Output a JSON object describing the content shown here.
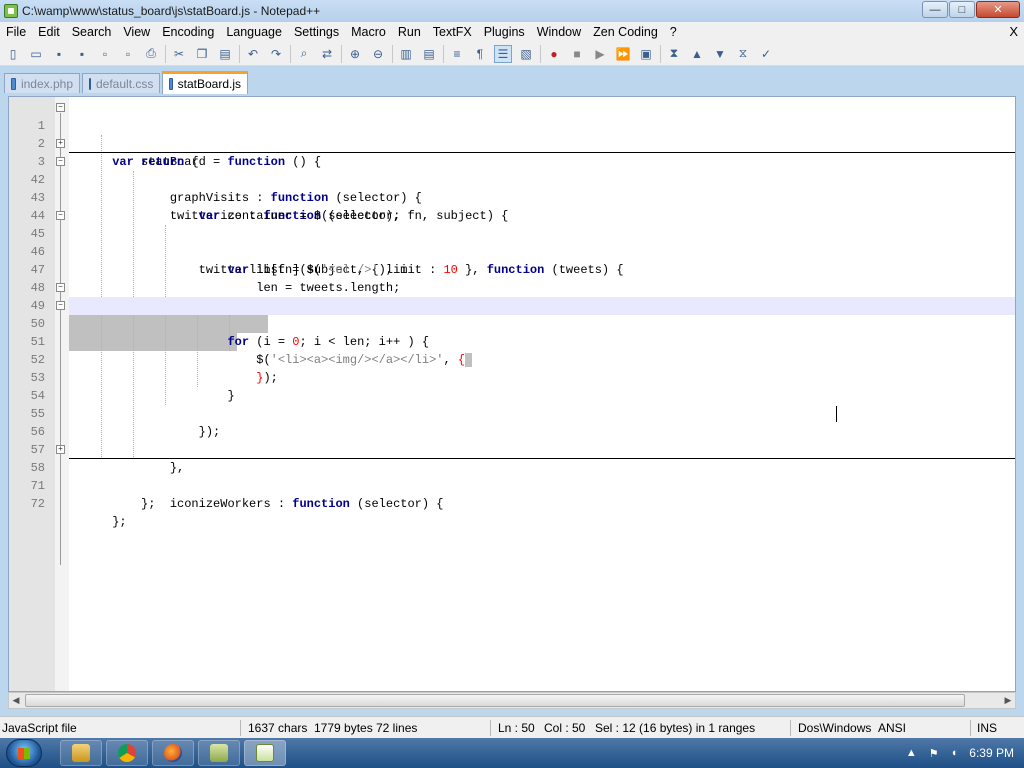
{
  "window": {
    "title": "C:\\wamp\\www\\status_board\\js\\statBoard.js - Notepad++",
    "minimize": "—",
    "maximize": "□",
    "close": "✕"
  },
  "menu": {
    "items": [
      "File",
      "Edit",
      "Search",
      "View",
      "Encoding",
      "Language",
      "Settings",
      "Macro",
      "Run",
      "TextFX",
      "Plugins",
      "Window",
      "Zen Coding",
      "?"
    ],
    "close_doc": "X"
  },
  "toolbar": {
    "icons": [
      "new-file-icon",
      "open-file-icon",
      "save-icon",
      "save-all-icon",
      "close-icon",
      "close-all-icon",
      "print-icon",
      "cut-icon",
      "copy-icon",
      "paste-icon",
      "undo-icon",
      "redo-icon",
      "find-icon",
      "replace-icon",
      "zoom-in-icon",
      "zoom-out-icon",
      "sync-vertical-icon",
      "sync-horizontal-icon",
      "word-wrap-icon",
      "show-all-chars-icon",
      "indent-guide-icon",
      "user-language-icon",
      "record-macro-icon",
      "stop-record-icon",
      "play-macro-icon",
      "run-macro-multiple-icon",
      "save-macro-icon",
      "fold-all-icon",
      "previous-icon",
      "next-icon",
      "unfold-icon",
      "spellcheck-icon"
    ]
  },
  "tabs": [
    {
      "label": "index.php",
      "active": false
    },
    {
      "label": "default.css",
      "active": false
    },
    {
      "label": "statBoard.js",
      "active": true
    }
  ],
  "editor": {
    "lines": [
      {
        "num": "1",
        "fold": "minus"
      },
      {
        "num": "2",
        "fold": ""
      },
      {
        "num": "3",
        "fold": "plus",
        "collapsed": true
      },
      {
        "num": "42",
        "fold": "minus"
      },
      {
        "num": "43",
        "fold": ""
      },
      {
        "num": "44",
        "fold": ""
      },
      {
        "num": "45",
        "fold": "minus"
      },
      {
        "num": "46",
        "fold": ""
      },
      {
        "num": "47",
        "fold": ""
      },
      {
        "num": "48",
        "fold": ""
      },
      {
        "num": "49",
        "fold": "minus"
      },
      {
        "num": "50",
        "fold": "minus",
        "current": true
      },
      {
        "num": "51",
        "fold": ""
      },
      {
        "num": "52",
        "fold": ""
      },
      {
        "num": "53",
        "fold": ""
      },
      {
        "num": "54",
        "fold": ""
      },
      {
        "num": "55",
        "fold": ""
      },
      {
        "num": "56",
        "fold": ""
      },
      {
        "num": "57",
        "fold": ""
      },
      {
        "num": "58",
        "fold": "plus",
        "collapsed": true
      },
      {
        "num": "71",
        "fold": ""
      },
      {
        "num": "72",
        "fold": ""
      }
    ],
    "code": {
      "l1": [
        "var",
        " statBoard = ",
        "function",
        " () {"
      ],
      "l2": [
        "return",
        " {"
      ],
      "l3": [
        "graphVisits : ",
        "function",
        " (selector) {"
      ],
      "l42": [
        "twitterize : ",
        "function",
        " (selector, fn, subject) {"
      ],
      "l43": [
        "var",
        " container = $(selector);"
      ],
      "l45": [
        "twitterlib[fn](subject, { limit : ",
        "10",
        " }, ",
        "function",
        " (tweets) {"
      ],
      "l46": [
        "var",
        " list = $(",
        "'<ul />'",
        "), i"
      ],
      "l47": [
        "len = tweets.length;"
      ],
      "l49": [
        "for",
        " (i = ",
        "0",
        "; i < len; i++ ) {"
      ],
      "l50": [
        "$(",
        "'<li><a><img/></a></li>'",
        ", ",
        "{"
      ],
      "l52": [
        "}",
        ");"
      ],
      "l53": [
        "}"
      ],
      "l55": [
        "});"
      ],
      "l57": [
        "},"
      ],
      "l58": [
        "iconizeWorkers : ",
        "function",
        " (selector) {"
      ],
      "l71": [
        "};"
      ],
      "l72": [
        "};"
      ]
    }
  },
  "status": {
    "file_type": "JavaScript file",
    "chars": "1637 chars",
    "bytes": "1779 bytes",
    "lines": "72 lines",
    "ln": "Ln : 50",
    "col": "Col : 50",
    "sel": "Sel : 12 (16 bytes) in 1 ranges",
    "eol": "Dos\\Windows",
    "encoding": "ANSI",
    "mode": "INS"
  },
  "taskbar": {
    "apps": [
      "explorer-icon",
      "chrome-icon",
      "firefox-icon",
      "folder-icon",
      "notepadpp-icon"
    ],
    "clock": "6:39 PM",
    "tray_arrow": "▲"
  }
}
